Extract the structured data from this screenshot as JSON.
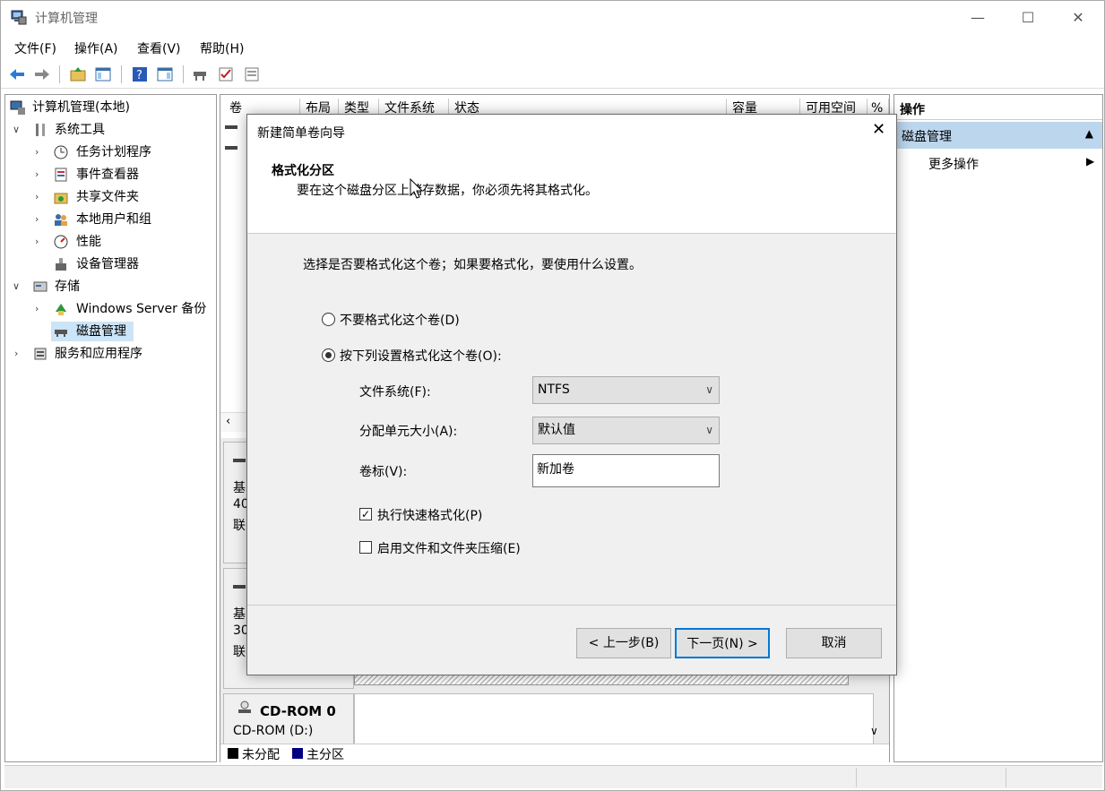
{
  "title": "计算机管理",
  "menu": [
    "文件(F)",
    "操作(A)",
    "查看(V)",
    "帮助(H)"
  ],
  "window_controls": [
    "—",
    "☐",
    "✕"
  ],
  "tree": {
    "root": "计算机管理(本地)",
    "system_tools": "系统工具",
    "task_scheduler": "任务计划程序",
    "event_viewer": "事件查看器",
    "shared_folders": "共享文件夹",
    "local_users": "本地用户和组",
    "performance": "性能",
    "device_manager": "设备管理器",
    "storage": "存储",
    "windows_backup": "Windows Server 备份",
    "disk_management": "磁盘管理",
    "services_apps": "服务和应用程序"
  },
  "volume_columns": [
    "卷",
    "布局",
    "类型",
    "文件系统",
    "状态",
    "容量",
    "可用空间",
    "%"
  ],
  "disk_rows": [
    {
      "line1": "基",
      "line2": "40",
      "line3": "联"
    },
    {
      "line1": "基",
      "line2": "30",
      "line3": "联"
    }
  ],
  "cdrom": {
    "name": "CD-ROM 0",
    "drive": "CD-ROM (D:)"
  },
  "legend": {
    "unallocated": "未分配",
    "primary": "主分区",
    "unallocated_color": "#000000",
    "primary_color": "#000080"
  },
  "actions": {
    "header": "操作",
    "section": "磁盘管理",
    "more": "更多操作"
  },
  "dialog": {
    "title": "新建简单卷向导",
    "heading": "格式化分区",
    "subheading": "要在这个磁盘分区上储存数据，你必须先将其格式化。",
    "prompt": "选择是否要格式化这个卷；如果要格式化，要使用什么设置。",
    "opt_no_format": "不要格式化这个卷(D)",
    "opt_format": "按下列设置格式化这个卷(O):",
    "fs_label": "文件系统(F):",
    "fs_value": "NTFS",
    "alloc_label": "分配单元大小(A):",
    "alloc_value": "默认值",
    "vol_label": "卷标(V):",
    "vol_value": "新加卷",
    "quick_format": "执行快速格式化(P)",
    "compress": "启用文件和文件夹压缩(E)",
    "back": "< 上一步(B)",
    "next": "下一页(N) >",
    "cancel": "取消",
    "selected_option": "format",
    "quick_format_checked": true,
    "compress_checked": false
  }
}
